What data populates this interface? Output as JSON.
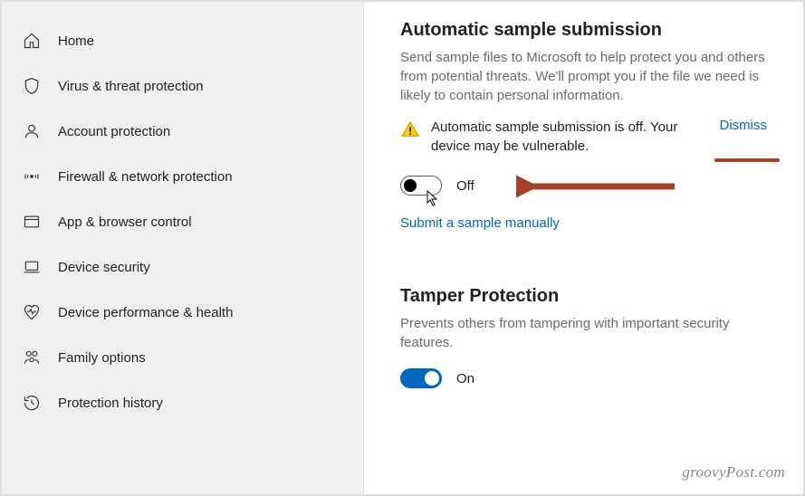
{
  "sidebar": {
    "items": [
      {
        "label": "Home"
      },
      {
        "label": "Virus & threat protection"
      },
      {
        "label": "Account protection"
      },
      {
        "label": "Firewall & network protection"
      },
      {
        "label": "App & browser control"
      },
      {
        "label": "Device security"
      },
      {
        "label": "Device performance & health"
      },
      {
        "label": "Family options"
      },
      {
        "label": "Protection history"
      }
    ]
  },
  "main": {
    "section1": {
      "title": "Automatic sample submission",
      "desc": "Send sample files to Microsoft to help protect you and others from potential threats. We'll prompt you if the file we need is likely to contain personal information.",
      "warning": "Automatic sample submission is off. Your device may be vulnerable.",
      "dismiss": "Dismiss",
      "toggle_label": "Off",
      "submit_link": "Submit a sample manually"
    },
    "section2": {
      "title": "Tamper Protection",
      "desc": "Prevents others from tampering with important security features.",
      "toggle_label": "On"
    }
  },
  "watermark": "groovyPost.com"
}
